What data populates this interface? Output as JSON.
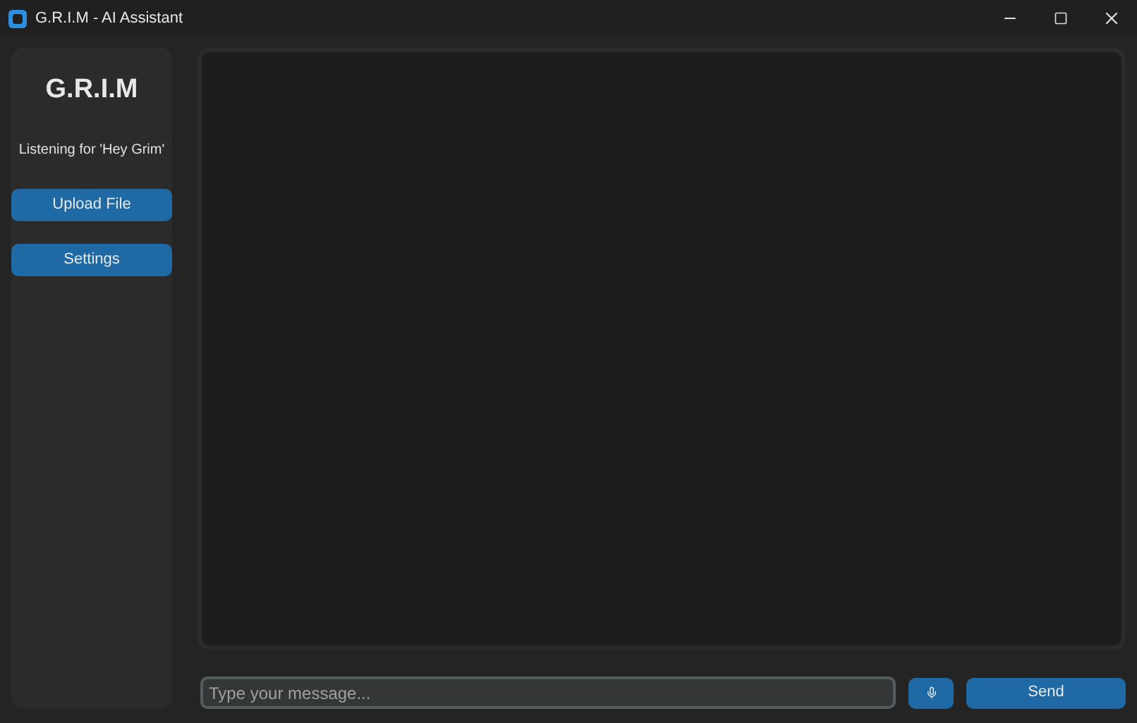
{
  "window": {
    "title": "G.R.I.M - AI Assistant"
  },
  "sidebar": {
    "title": "G.R.I.M",
    "status": "Listening for 'Hey Grim'",
    "buttons": [
      "Upload File",
      "Settings"
    ]
  },
  "input": {
    "placeholder": "Type your message..."
  },
  "send_button": "Send"
}
